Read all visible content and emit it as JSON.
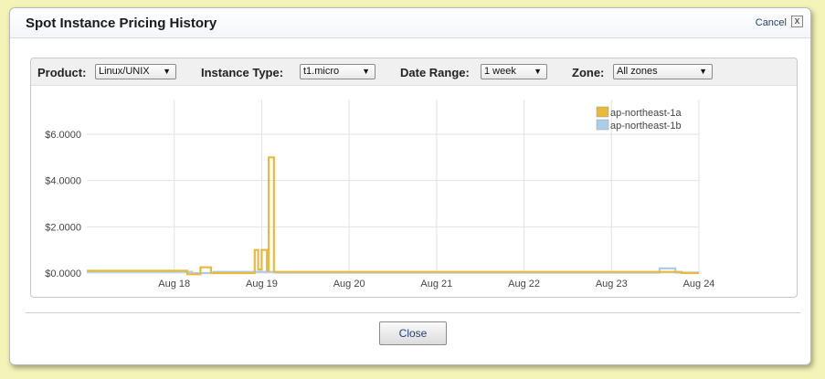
{
  "dialog": {
    "title": "Spot Instance Pricing History",
    "cancel_label": "Cancel",
    "cancel_x": "x",
    "close_label": "Close"
  },
  "filters": {
    "product_label": "Product:",
    "product_value": "Linux/UNIX",
    "instance_type_label": "Instance Type:",
    "instance_type_value": "t1.micro",
    "date_range_label": "Date Range:",
    "date_range_value": "1 week",
    "zone_label": "Zone:",
    "zone_value": "All zones"
  },
  "icons": {
    "dropdown": "triangle-down-icon",
    "close": "close-icon"
  },
  "chart_data": {
    "type": "line",
    "title": "",
    "xlabel": "",
    "ylabel": "",
    "x_ticks": [
      "Aug 18",
      "Aug 19",
      "Aug 20",
      "Aug 21",
      "Aug 22",
      "Aug 23",
      "Aug 24"
    ],
    "y_ticks": [
      "$0.0000",
      "$2.0000",
      "$4.0000",
      "$6.0000"
    ],
    "ylim": [
      0,
      7.5
    ],
    "xlim": [
      17.0,
      24.0
    ],
    "grid": true,
    "legend_position": "top-right",
    "series": [
      {
        "name": "ap-northeast-1a",
        "color": "#e8b93a",
        "points": [
          [
            17.0,
            0.1
          ],
          [
            18.15,
            0.1
          ],
          [
            18.15,
            -0.05
          ],
          [
            18.3,
            -0.05
          ],
          [
            18.3,
            0.25
          ],
          [
            18.42,
            0.25
          ],
          [
            18.42,
            0.0
          ],
          [
            18.92,
            0.0
          ],
          [
            18.92,
            1.0
          ],
          [
            18.96,
            1.0
          ],
          [
            18.96,
            0.15
          ],
          [
            19.0,
            0.15
          ],
          [
            19.0,
            1.0
          ],
          [
            19.06,
            1.0
          ],
          [
            19.06,
            0.1
          ],
          [
            19.08,
            0.1
          ],
          [
            19.08,
            5.0
          ],
          [
            19.14,
            5.0
          ],
          [
            19.14,
            0.05
          ],
          [
            23.8,
            0.05
          ],
          [
            23.8,
            0.0
          ],
          [
            24.0,
            0.0
          ]
        ]
      },
      {
        "name": "ap-northeast-1b",
        "color": "#a9ceec",
        "points": [
          [
            17.0,
            0.05
          ],
          [
            18.2,
            0.05
          ],
          [
            18.2,
            0.0
          ],
          [
            18.45,
            0.0
          ],
          [
            18.45,
            0.05
          ],
          [
            19.15,
            0.05
          ],
          [
            19.15,
            0.02
          ],
          [
            23.55,
            0.02
          ],
          [
            23.55,
            0.2
          ],
          [
            23.73,
            0.2
          ],
          [
            23.73,
            0.02
          ],
          [
            24.0,
            0.02
          ]
        ]
      }
    ]
  }
}
